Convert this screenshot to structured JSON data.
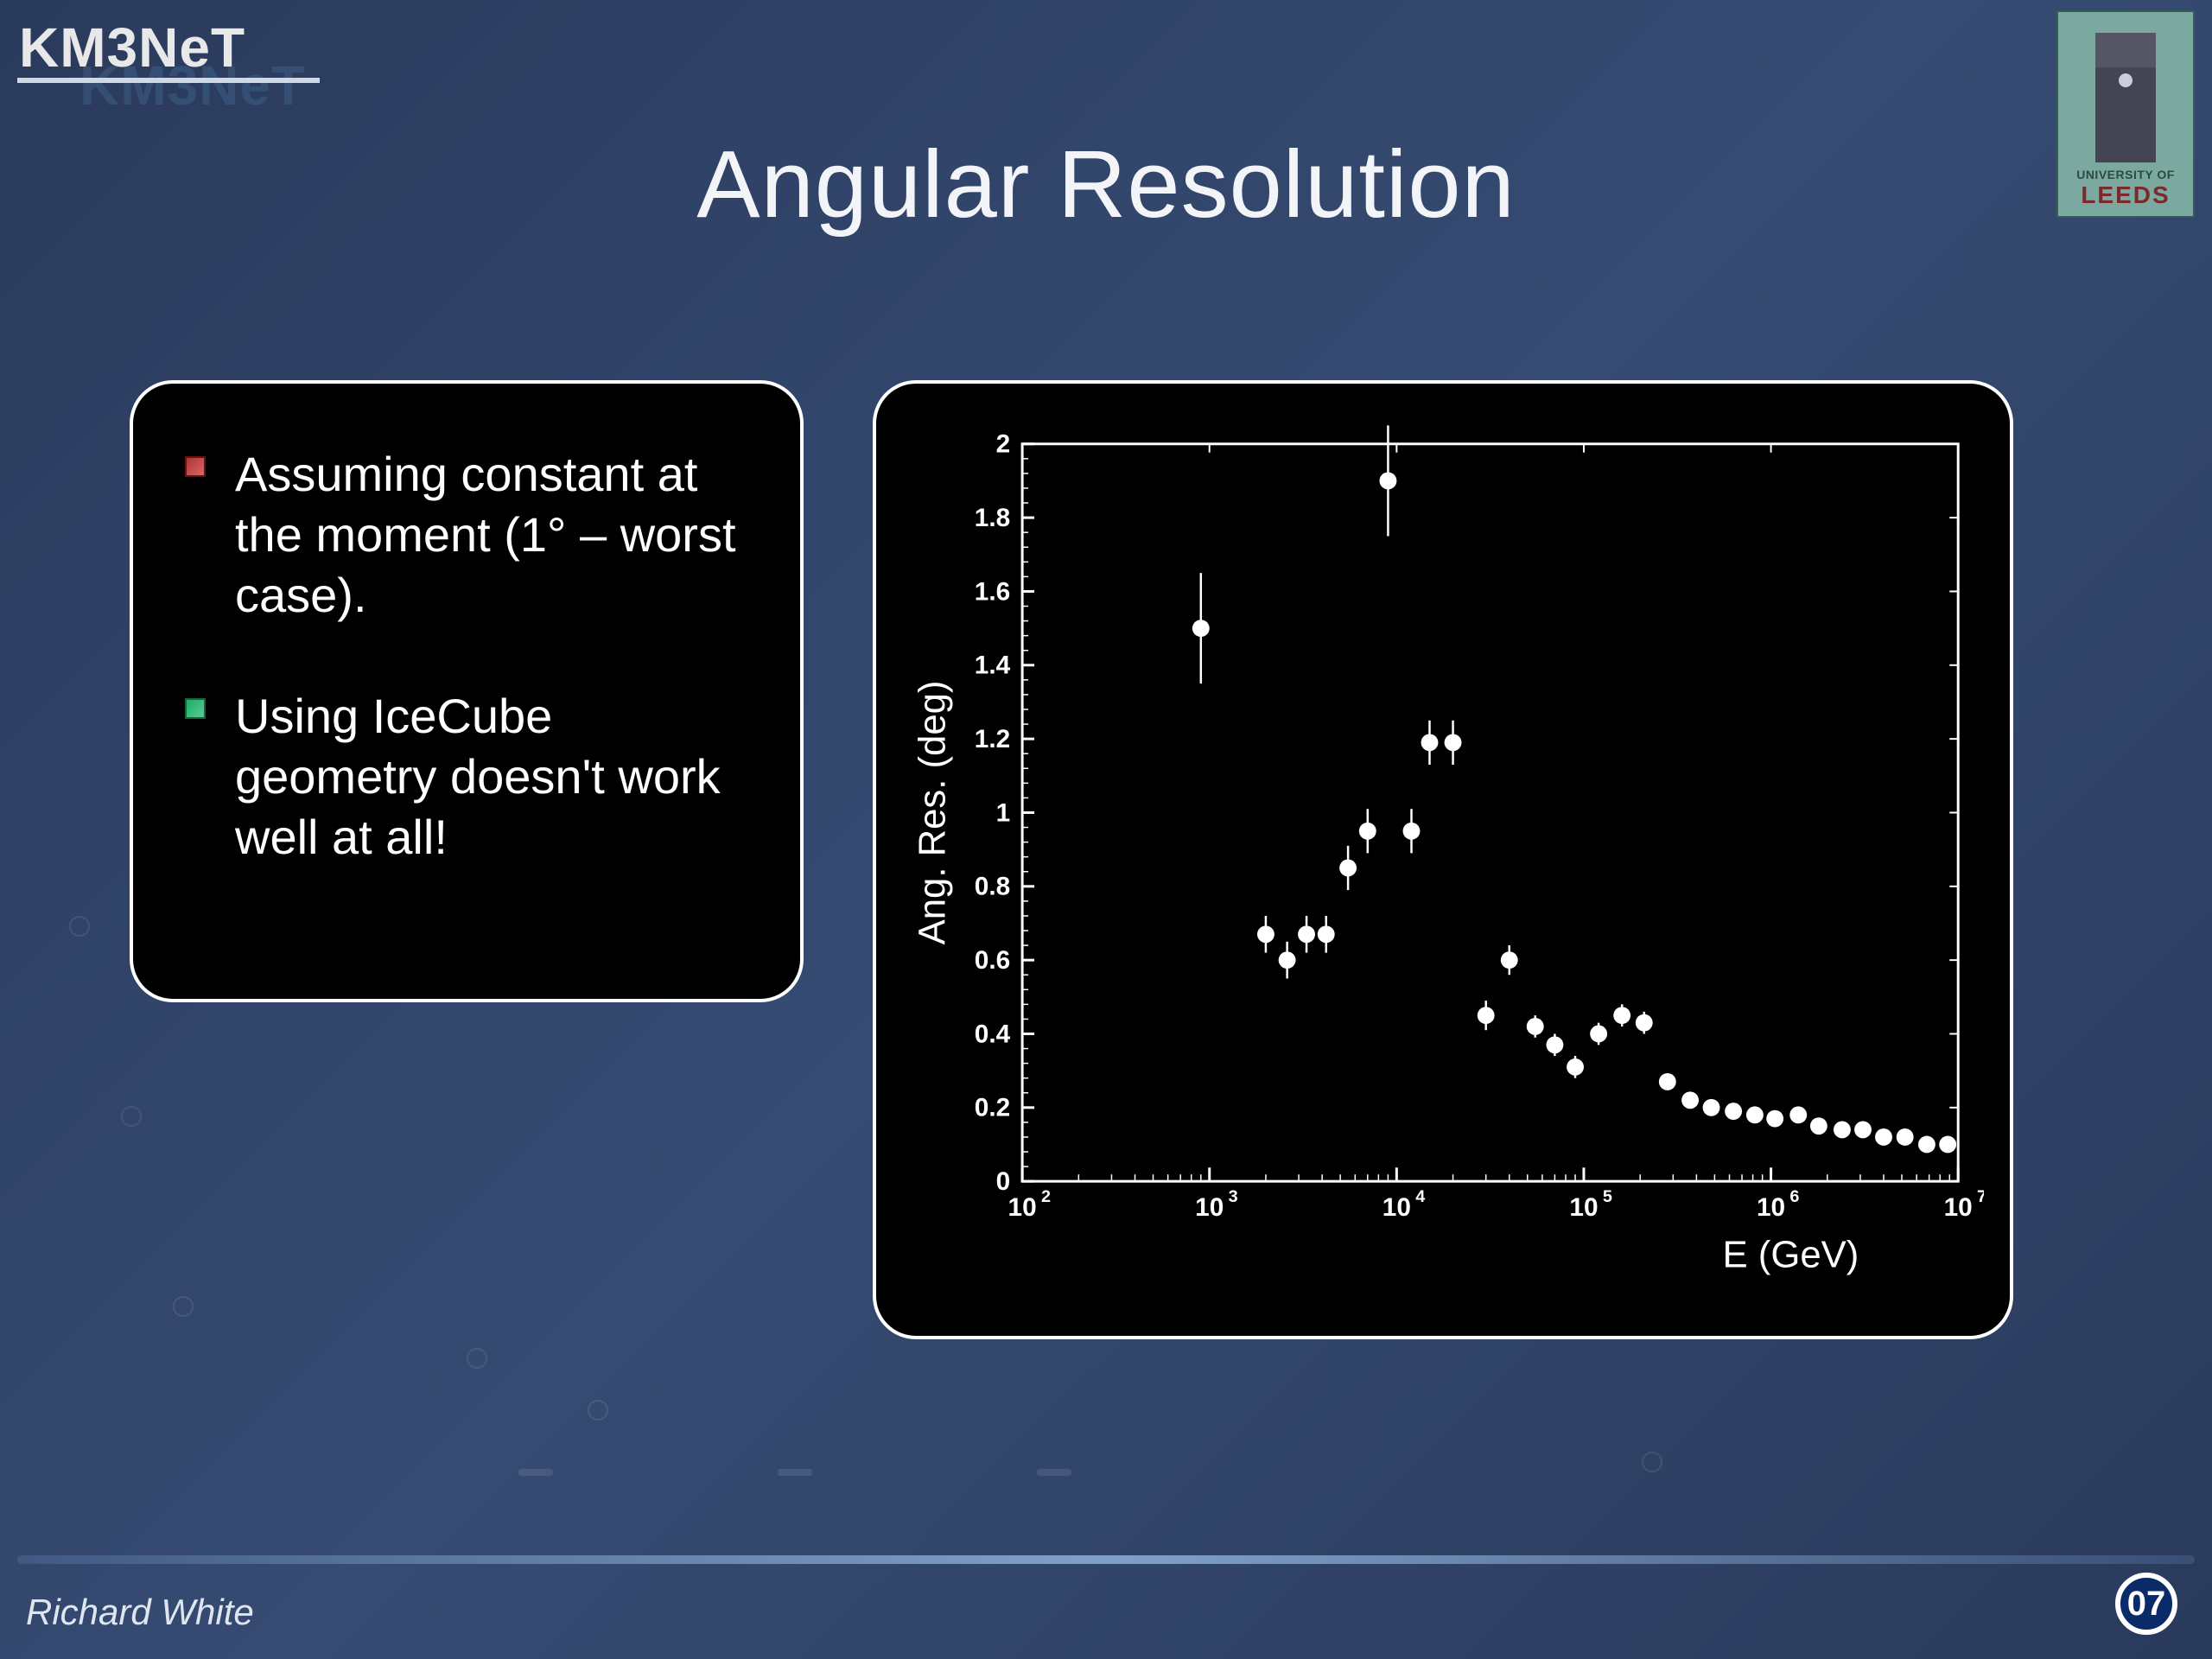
{
  "header": {
    "logo_text": "KM3NeT",
    "title": "Angular Resolution"
  },
  "leeds": {
    "line1": "UNIVERSITY OF",
    "line2": "LEEDS"
  },
  "bullets": [
    {
      "color": "red",
      "text": "Assuming constant at the moment (1° – worst case)."
    },
    {
      "color": "green",
      "text": "Using IceCube geometry doesn't work well at all!"
    }
  ],
  "chart_data": {
    "type": "scatter",
    "title": "",
    "xlabel": "E (GeV)",
    "ylabel": "Ang. Res. (deg)",
    "xscale": "log",
    "xlim": [
      100,
      10000000
    ],
    "ylim": [
      0,
      2
    ],
    "yticks": [
      0,
      0.2,
      0.4,
      0.6,
      0.8,
      1,
      1.2,
      1.4,
      1.6,
      1.8,
      2
    ],
    "xticks_exp": [
      2,
      3,
      4,
      5,
      6,
      7
    ],
    "series": [
      {
        "name": "angular_resolution",
        "points": [
          {
            "x": 900,
            "y": 1.5,
            "err": 0.15
          },
          {
            "x": 2000,
            "y": 0.67,
            "err": 0.05
          },
          {
            "x": 2600,
            "y": 0.6,
            "err": 0.05
          },
          {
            "x": 3300,
            "y": 0.67,
            "err": 0.05
          },
          {
            "x": 4200,
            "y": 0.67,
            "err": 0.05
          },
          {
            "x": 5500,
            "y": 0.85,
            "err": 0.06
          },
          {
            "x": 7000,
            "y": 0.95,
            "err": 0.06
          },
          {
            "x": 9000,
            "y": 1.9,
            "err": 0.15
          },
          {
            "x": 12000,
            "y": 0.95,
            "err": 0.06
          },
          {
            "x": 15000,
            "y": 1.19,
            "err": 0.06
          },
          {
            "x": 20000,
            "y": 1.19,
            "err": 0.06
          },
          {
            "x": 30000,
            "y": 0.45,
            "err": 0.04
          },
          {
            "x": 40000,
            "y": 0.6,
            "err": 0.04
          },
          {
            "x": 55000,
            "y": 0.42,
            "err": 0.03
          },
          {
            "x": 70000,
            "y": 0.37,
            "err": 0.03
          },
          {
            "x": 90000,
            "y": 0.31,
            "err": 0.03
          },
          {
            "x": 120000,
            "y": 0.4,
            "err": 0.03
          },
          {
            "x": 160000,
            "y": 0.45,
            "err": 0.03
          },
          {
            "x": 210000,
            "y": 0.43,
            "err": 0.03
          },
          {
            "x": 280000,
            "y": 0.27,
            "err": 0.02
          },
          {
            "x": 370000,
            "y": 0.22,
            "err": 0.02
          },
          {
            "x": 480000,
            "y": 0.2,
            "err": 0.02
          },
          {
            "x": 630000,
            "y": 0.19,
            "err": 0.02
          },
          {
            "x": 820000,
            "y": 0.18,
            "err": 0.02
          },
          {
            "x": 1050000,
            "y": 0.17,
            "err": 0.02
          },
          {
            "x": 1400000,
            "y": 0.18,
            "err": 0.02
          },
          {
            "x": 1800000,
            "y": 0.15,
            "err": 0.02
          },
          {
            "x": 2400000,
            "y": 0.14,
            "err": 0.02
          },
          {
            "x": 3100000,
            "y": 0.14,
            "err": 0.02
          },
          {
            "x": 4000000,
            "y": 0.12,
            "err": 0.02
          },
          {
            "x": 5200000,
            "y": 0.12,
            "err": 0.02
          },
          {
            "x": 6800000,
            "y": 0.1,
            "err": 0.02
          },
          {
            "x": 8800000,
            "y": 0.1,
            "err": 0.02
          }
        ]
      }
    ]
  },
  "footer": {
    "author": "Richard White",
    "page": "07"
  }
}
